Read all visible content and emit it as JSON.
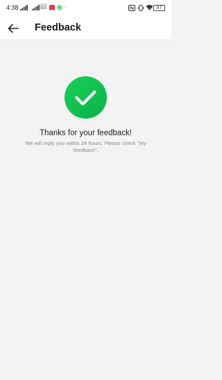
{
  "status_bar": {
    "time": "4:38",
    "network_speed_value": "22.8",
    "network_speed_unit": "KB/S",
    "dots": "···",
    "battery": "97",
    "icons": [
      "signal-icon",
      "signal-icon",
      "app-badge-red",
      "whatsapp-icon",
      "nfc-icon",
      "vibrate-icon",
      "wifi-icon",
      "battery-icon"
    ]
  },
  "header": {
    "title": "Feedback",
    "back_icon": "back-arrow-icon"
  },
  "content": {
    "success_icon": "check-circle-icon",
    "success_color": "#14c552",
    "title": "Thanks for your feedback!",
    "message": "We will reply you within 24 hours. Please check \"My feedback\"."
  }
}
